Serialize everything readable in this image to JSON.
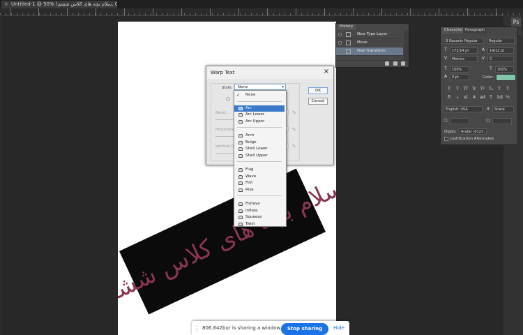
{
  "document": {
    "tab_title": "Untitled-1 @ 50% (سلام بچه های کلاس ششم, CMYK/8) *",
    "close_glyph": "×",
    "canvas_text": "سلام بچه های کلاس ششم"
  },
  "history_panel": {
    "tab": "History",
    "rows": [
      {
        "label": "New Type Layer",
        "icon": "type-tool-icon",
        "selected": false
      },
      {
        "label": "Move",
        "icon": "move-tool-icon",
        "selected": false
      },
      {
        "label": "Free Transform",
        "icon": "transform-icon",
        "selected": true
      }
    ]
  },
  "character_panel": {
    "tabs": [
      "Character",
      "Paragraph"
    ],
    "font_family": "B Nazanin Regular",
    "font_style": "Regular",
    "font_size": "172/14 pt",
    "leading": "14/12 pt",
    "kerning": "Metrics",
    "tracking": "0",
    "vertical_scale": "100%",
    "horizontal_scale": "100%",
    "baseline_shift": "0 pt",
    "color_label": "Color:",
    "color": "#7fc7a8",
    "style_glyphs": [
      "T",
      "T",
      "TT",
      "Tr",
      "T¹",
      "T₁",
      "T",
      "T"
    ],
    "opentype_glyphs": [
      "fi",
      "ℴ",
      "st",
      "A",
      "ad",
      "T",
      "1st",
      "½"
    ],
    "language": "English: USA",
    "antialias": "Sharp",
    "scale_a": "",
    "scale_b": "",
    "digits_label": "Digits:",
    "digits_value": "Arabic (0123...)",
    "justification_label": "Justification Alternates"
  },
  "warp_dialog": {
    "title": "Warp Text",
    "close_glyph": "×",
    "style_label": "Style:",
    "style_value": "None",
    "ok_label": "OK",
    "cancel_label": "Cancel",
    "params": [
      {
        "label": "Bend:",
        "pct": "%"
      },
      {
        "label": "Horizontal",
        "pct": "%"
      },
      {
        "label": "Vertical D",
        "pct": "%"
      }
    ],
    "options": [
      {
        "group": 0,
        "label": "None",
        "checked": true,
        "selected": false
      },
      {
        "group": 1,
        "label": "Arc",
        "checked": false,
        "selected": true
      },
      {
        "group": 1,
        "label": "Arc Lower",
        "checked": false,
        "selected": false
      },
      {
        "group": 1,
        "label": "Arc Upper",
        "checked": false,
        "selected": false
      },
      {
        "group": 2,
        "label": "Arch",
        "checked": false,
        "selected": false
      },
      {
        "group": 2,
        "label": "Bulge",
        "checked": false,
        "selected": false
      },
      {
        "group": 2,
        "label": "Shell Lower",
        "checked": false,
        "selected": false
      },
      {
        "group": 2,
        "label": "Shell Upper",
        "checked": false,
        "selected": false
      },
      {
        "group": 3,
        "label": "Flag",
        "checked": false,
        "selected": false
      },
      {
        "group": 3,
        "label": "Wave",
        "checked": false,
        "selected": false
      },
      {
        "group": 3,
        "label": "Fish",
        "checked": false,
        "selected": false
      },
      {
        "group": 3,
        "label": "Rise",
        "checked": false,
        "selected": false
      },
      {
        "group": 4,
        "label": "Fisheye",
        "checked": false,
        "selected": false
      },
      {
        "group": 4,
        "label": "Inflate",
        "checked": false,
        "selected": false
      },
      {
        "group": 4,
        "label": "Squeeze",
        "checked": false,
        "selected": false
      },
      {
        "group": 4,
        "label": "Twist",
        "checked": false,
        "selected": false
      }
    ]
  },
  "share_bar": {
    "text": "806.642bur is sharing a window.",
    "stop_label": "Stop sharing",
    "hide_label": "Hide"
  },
  "dock": {
    "icon_label": "Ps"
  }
}
